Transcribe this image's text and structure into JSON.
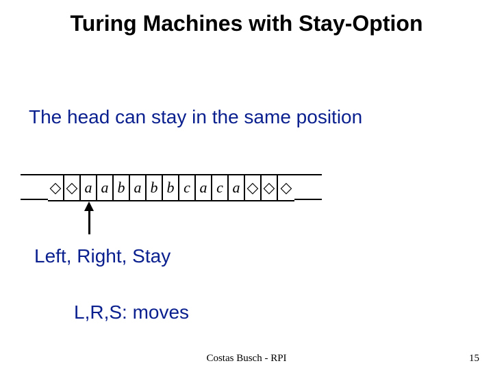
{
  "title": "Turing Machines with Stay-Option",
  "subtitle": "The head can stay in the same position",
  "tape": {
    "blank_symbol": "◇",
    "cells": [
      "◇",
      "◇",
      "a",
      "a",
      "b",
      "a",
      "b",
      "b",
      "c",
      "a",
      "c",
      "a",
      "◇",
      "◇",
      "◇"
    ],
    "head_index": 2
  },
  "lrs_label": "Left, Right, Stay",
  "moves_label": "L,R,S: moves",
  "footer": "Costas Busch - RPI",
  "page_number": "15"
}
